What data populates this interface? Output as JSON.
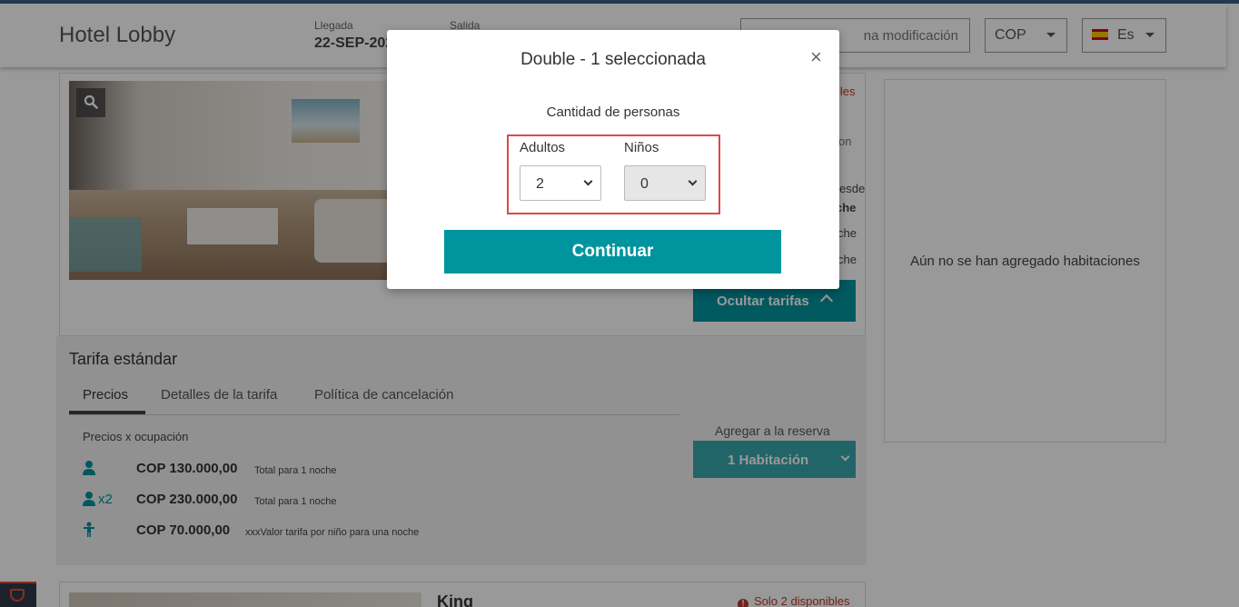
{
  "header": {
    "brand": "Hotel Lobby",
    "arrival_label": "Llegada",
    "arrival_value": "22-SEP-202",
    "departure_label": "Salida",
    "modification_text": "na modificación",
    "currency": "COP",
    "language": "Es"
  },
  "room": {
    "fragments": {
      "availability": "iles",
      "info": "on",
      "from": "esde",
      "per_night": "che",
      "night_a": "che",
      "night_b": "che"
    },
    "hide_rates_button": "Ocultar tarifas"
  },
  "cart": {
    "empty_text": "Aún no se han agregado habitaciones"
  },
  "rate": {
    "title": "Tarifa estándar",
    "tabs": [
      {
        "label": "Precios"
      },
      {
        "label": "Detalles de la tarifa"
      },
      {
        "label": "Política de cancelación"
      }
    ],
    "occupancy_label": "Precios x ocupación",
    "prices": [
      {
        "icon": "person-icon",
        "multiplier": "",
        "amount": "COP 130.000,00",
        "note": "Total para 1 noche"
      },
      {
        "icon": "person-icon",
        "multiplier": "x2",
        "amount": "COP 230.000,00",
        "note": "Total para 1 noche"
      },
      {
        "icon": "child-icon",
        "multiplier": "",
        "amount": "COP 70.000,00",
        "note": "xxxValor tarifa por niño para una noche"
      }
    ],
    "add_label": "Agregar a la reserva",
    "add_select_value": "1 Habitación"
  },
  "room2": {
    "name": "King",
    "availability": "Solo 2 disponibles"
  },
  "modal": {
    "title": "Double - 1 seleccionada",
    "close_glyph": "×",
    "subtitle": "Cantidad de personas",
    "adults_label": "Adultos",
    "adults_value": "2",
    "children_label": "Niños",
    "children_value": "0",
    "continue_label": "Continuar"
  },
  "colors": {
    "accent": "#00959e",
    "highlight": "#e04646",
    "alert": "#c0392b"
  }
}
